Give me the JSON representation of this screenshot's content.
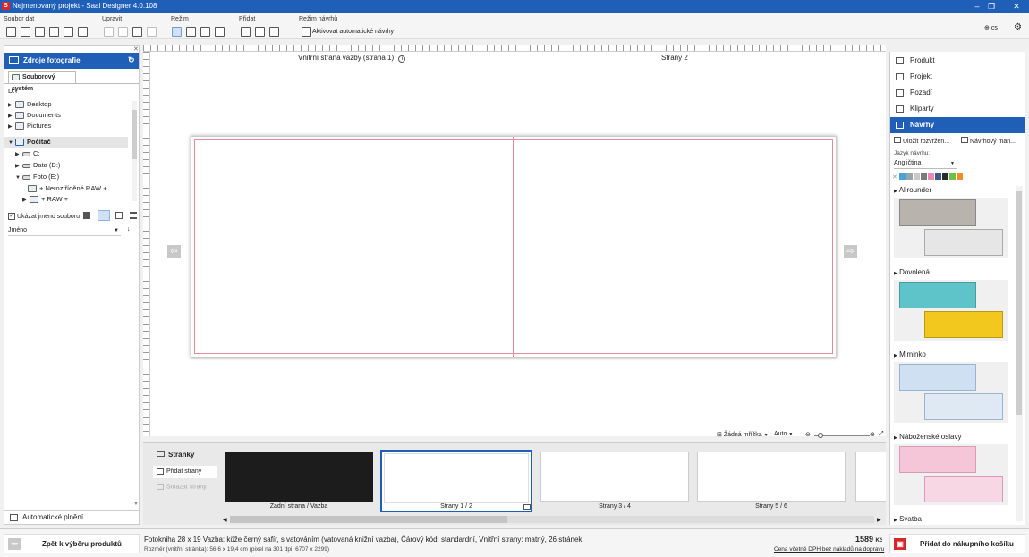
{
  "window": {
    "title": "Nejmenovaný projekt - Saal Designer 4.0.108",
    "app_icon": "S"
  },
  "ribbon": {
    "groups": {
      "file": "Soubor dat",
      "edit": "Upravit",
      "mode": "Režim",
      "add": "Přidat",
      "template_mode": "Režim návrhů"
    },
    "auto_templates": "Aktivovat automatické návrhy",
    "language": "cs"
  },
  "left_panel": {
    "title": "Zdroje fotografie",
    "tab": "Souborový systém",
    "path": "D:\\",
    "tree": [
      "Desktop",
      "Documents",
      "Pictures"
    ],
    "computer": "Počítač",
    "drives": [
      "C:",
      "Data (D:)",
      "Foto (E:)"
    ],
    "folders": [
      "+ Neroztříděné RAW +",
      "+ RAW +"
    ],
    "show_filename": "Ukázat jméno souboru",
    "sort": "Jméno",
    "autofill": "Automatické plnění"
  },
  "canvas": {
    "page_left_label": "Vnitřní strana vazby (strana 1)",
    "page_right_label": "Strany 2",
    "grid": "Žádná mřížka",
    "zoom": "Auto"
  },
  "right_panel": {
    "items": [
      "Produkt",
      "Projekt",
      "Pozadí",
      "Kliparty",
      "Návrhy"
    ],
    "save_layout": "Uložit rozvržen...",
    "template_manager": "Návrhový man...",
    "lang_label": "Jazyk návrhu:",
    "lang_value": "Angličtina",
    "swatch_colors": [
      "#4aa3d8",
      "#9aa4ad",
      "#c8c8c8",
      "#7a7a7a",
      "#e889b3",
      "#3d5a8a",
      "#2b2b2b",
      "#6bbf4a",
      "#f28c28"
    ],
    "categories": [
      "Allrounder",
      "Dovolená",
      "Miminko",
      "Náboženské oslavy",
      "Svatba"
    ]
  },
  "pages_panel": {
    "title": "Stránky",
    "add": "Přidat strany",
    "delete": "Smazat strany",
    "thumbs": [
      "Zadní strana / Vazba",
      "Strany 1 / 2",
      "Strany 3 / 4",
      "Strany 5 / 6"
    ]
  },
  "status": {
    "back": "Zpět k výběru produktů",
    "product_line1": "Fotokniha 28 x 19 Vazba: kůže černý safír, s vatováním (vatovaná knižní vazba), Čárový kód: standardní, Vnitřní strany: matný, 26 stránek",
    "product_line2": "Rozměr (vnitřní stránka): 56,6 x 19,4 cm (pixel na 301 dpi: 6707 x 2299)",
    "price": "1589",
    "currency": "Kč",
    "price_note": "Cena včetně DPH bez nákladů na dopravu",
    "cart": "Přidat do nákupního košíku"
  },
  "colors": {
    "accent": "#1f5fb8",
    "cart_red": "#d9262b",
    "bleed_line": "#e58aa0"
  }
}
